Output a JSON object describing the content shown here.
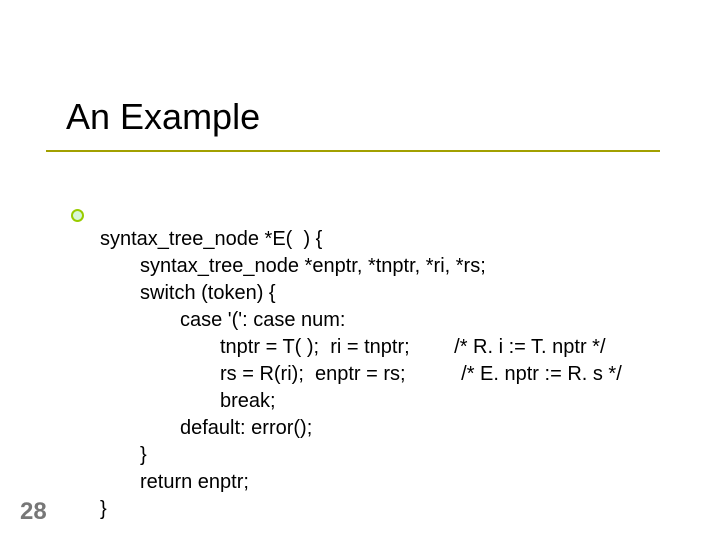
{
  "slide": {
    "title": "An Example",
    "page_number": "28",
    "code": {
      "l1": "syntax_tree_node *E(  ) {",
      "l2": "syntax_tree_node *enptr, *tnptr, *ri, *rs;",
      "l3": "switch (token) {",
      "l4": "case '(': case num:",
      "l5": "tnptr = T( );  ri = tnptr;        /* R. i := T. nptr */",
      "l6": "rs = R(ri);  enptr = rs;          /* E. nptr := R. s */",
      "l7": "break;",
      "l8": "default: error();",
      "l9": "}",
      "l10": "return enptr;",
      "l11": "}"
    }
  }
}
